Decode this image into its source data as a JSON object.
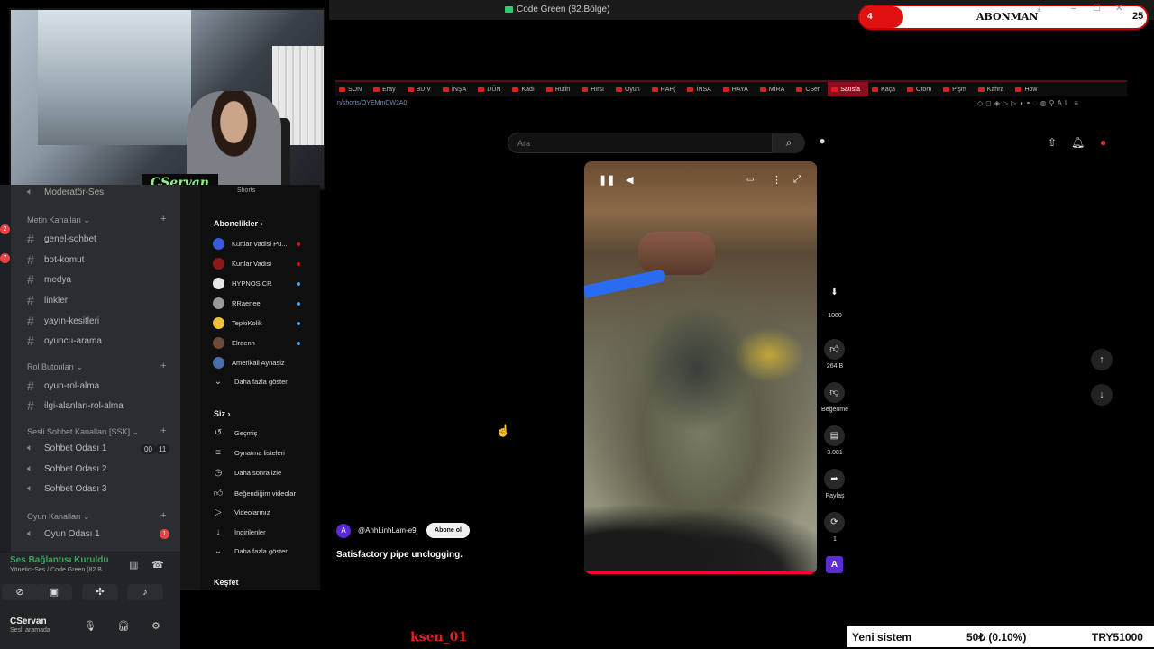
{
  "window": {
    "title": "Code Green (82.Bölge)"
  },
  "webcam": {
    "name_tag": "CServan"
  },
  "subscriber_widget": {
    "count": "4",
    "label": "ABONMAN",
    "goal": "25"
  },
  "browser": {
    "tabs": [
      {
        "label": "SON"
      },
      {
        "label": "Eray"
      },
      {
        "label": "BU V"
      },
      {
        "label": "İNŞA"
      },
      {
        "label": "DÜN"
      },
      {
        "label": "Kadı"
      },
      {
        "label": "Rutin"
      },
      {
        "label": "Hırsı"
      },
      {
        "label": "Oyun"
      },
      {
        "label": "RAP("
      },
      {
        "label": "İNSA"
      },
      {
        "label": "HAYA"
      },
      {
        "label": "MİRA"
      },
      {
        "label": "CSer"
      },
      {
        "label": "Satısfa"
      },
      {
        "label": "Kaça"
      },
      {
        "label": "Otom"
      },
      {
        "label": "Pişm"
      },
      {
        "label": "Kahra"
      },
      {
        "label": "How"
      }
    ],
    "active_tab_index": 14,
    "url": "n/shorts/OYEMmDW2A0"
  },
  "youtube": {
    "search_placeholder": "Ara",
    "sidebar": {
      "shorts_label": "Shorts",
      "subscriptions_title": "Abonelikler",
      "subscriptions": [
        {
          "name": "Kurtlar Vadisi Pu...",
          "color": "#3b5bdb",
          "live": "#e01010"
        },
        {
          "name": "Kurtlar Vadisi",
          "color": "#8b1a1a",
          "live": "#e01010"
        },
        {
          "name": "HYPNOS CR",
          "color": "#e8e8e8",
          "live": "#3ea6ff"
        },
        {
          "name": "RRaenee",
          "color": "#999999",
          "live": "#3ea6ff"
        },
        {
          "name": "TepkiKolik",
          "color": "#f0c040",
          "live": "#3ea6ff"
        },
        {
          "name": "Elraenn",
          "color": "#6b4a3a",
          "live": "#3ea6ff"
        },
        {
          "name": "Amerikali Aynasiz",
          "color": "#4a6fa8",
          "live": ""
        }
      ],
      "show_more": "Daha fazla göster",
      "you_title": "Siz",
      "you_items": [
        {
          "label": "Geçmiş",
          "icon": "history-icon"
        },
        {
          "label": "Oynatma listeleri",
          "icon": "playlist-icon"
        },
        {
          "label": "Daha sonra izle",
          "icon": "clock-icon"
        },
        {
          "label": "Beğendiğim videolar",
          "icon": "thumbs-up-icon"
        },
        {
          "label": "Videolarınız",
          "icon": "video-icon"
        },
        {
          "label": "İndirilenler",
          "icon": "download-icon"
        }
      ],
      "show_more_2": "Daha fazla göster",
      "explore_title": "Keşfet"
    },
    "video": {
      "channel_handle": "@AnhLinhLam-e9j",
      "channel_initial": "A",
      "subscribe_label": "Abone ol",
      "title": "Satisfactory pipe unclogging.",
      "actions": {
        "download_quality": "1080",
        "like_count": "264 B",
        "dislike_label": "Beğenme",
        "comment_count": "3.081",
        "share_label": "Paylaş",
        "remix_count": "1"
      }
    }
  },
  "discord": {
    "top_channel": "Moderatör-Ses",
    "categories": [
      {
        "name": "Metin Kanalları",
        "channels": [
          "genel-sohbet",
          "bot-komut",
          "medya",
          "linkler",
          "yayın-kesitleri",
          "oyuncu-arama"
        ]
      },
      {
        "name": "Rol Butonları",
        "channels": [
          "oyun-rol-alma",
          "ilgi-alanları-rol-alma"
        ]
      },
      {
        "name": "Sesli Sohbet Kanalları [SSK]",
        "channels": [
          "Sohbet Odası 1",
          "Sohbet Odası 2",
          "Sohbet Odası 3"
        ]
      },
      {
        "name": "Oyun Kanalları",
        "channels": [
          "Oyun Odası 1"
        ]
      }
    ],
    "voice_counts": {
      "room1_a": "00",
      "room1_b": "11"
    },
    "game_room_badge": "1",
    "voice_status": "Ses Bağlantısı Kuruldu",
    "voice_sub": "Yönetici-Ses / Code Green (82.B...",
    "user": {
      "name": "CServan",
      "status": "Sesli aramada"
    }
  },
  "overlays": {
    "name_tag": "ksen_01",
    "donation": {
      "label": "Yeni sistem",
      "amount": "50₺ (0.10%)",
      "goal": "TRY51000"
    }
  },
  "colors": {
    "youtube_red": "#ff0033",
    "discord_bg": "#2b2d31",
    "voice_green": "#3ba55d",
    "brand_purple": "#5b2bd6"
  }
}
